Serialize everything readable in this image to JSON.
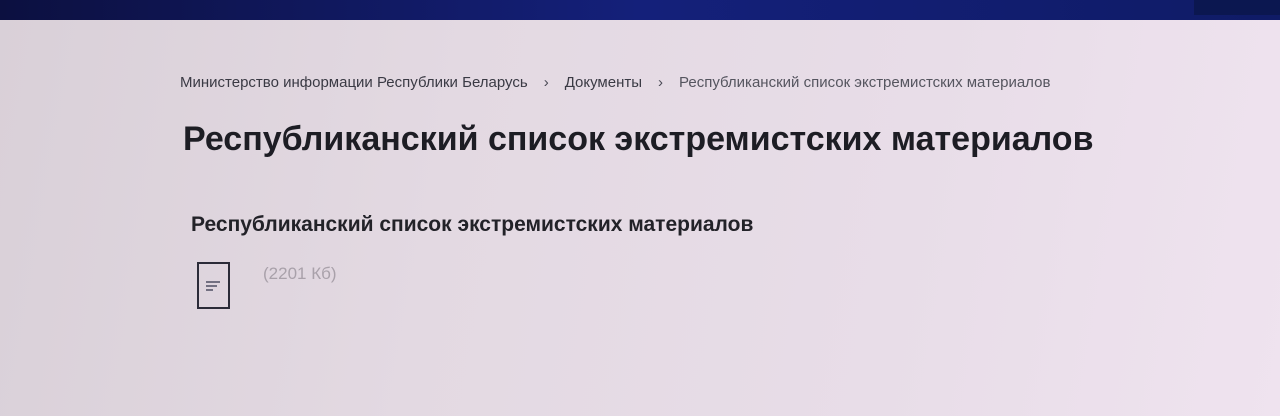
{
  "breadcrumb": {
    "items": [
      {
        "label": "Министерство информации Республики Беларусь"
      },
      {
        "label": "Документы"
      },
      {
        "label": "Республиканский список экстремистских материалов"
      }
    ],
    "separator": "›"
  },
  "page": {
    "title": "Республиканский список экстремистских материалов"
  },
  "document": {
    "section_title": "Республиканский список экстремистских материалов",
    "file_icon": "document-icon",
    "file_size": "(2201 Кб)"
  },
  "colors": {
    "top_bar": "#14207a",
    "background": "#e6dce6",
    "text": "#1e1e24",
    "muted": "#a9a1aa"
  }
}
